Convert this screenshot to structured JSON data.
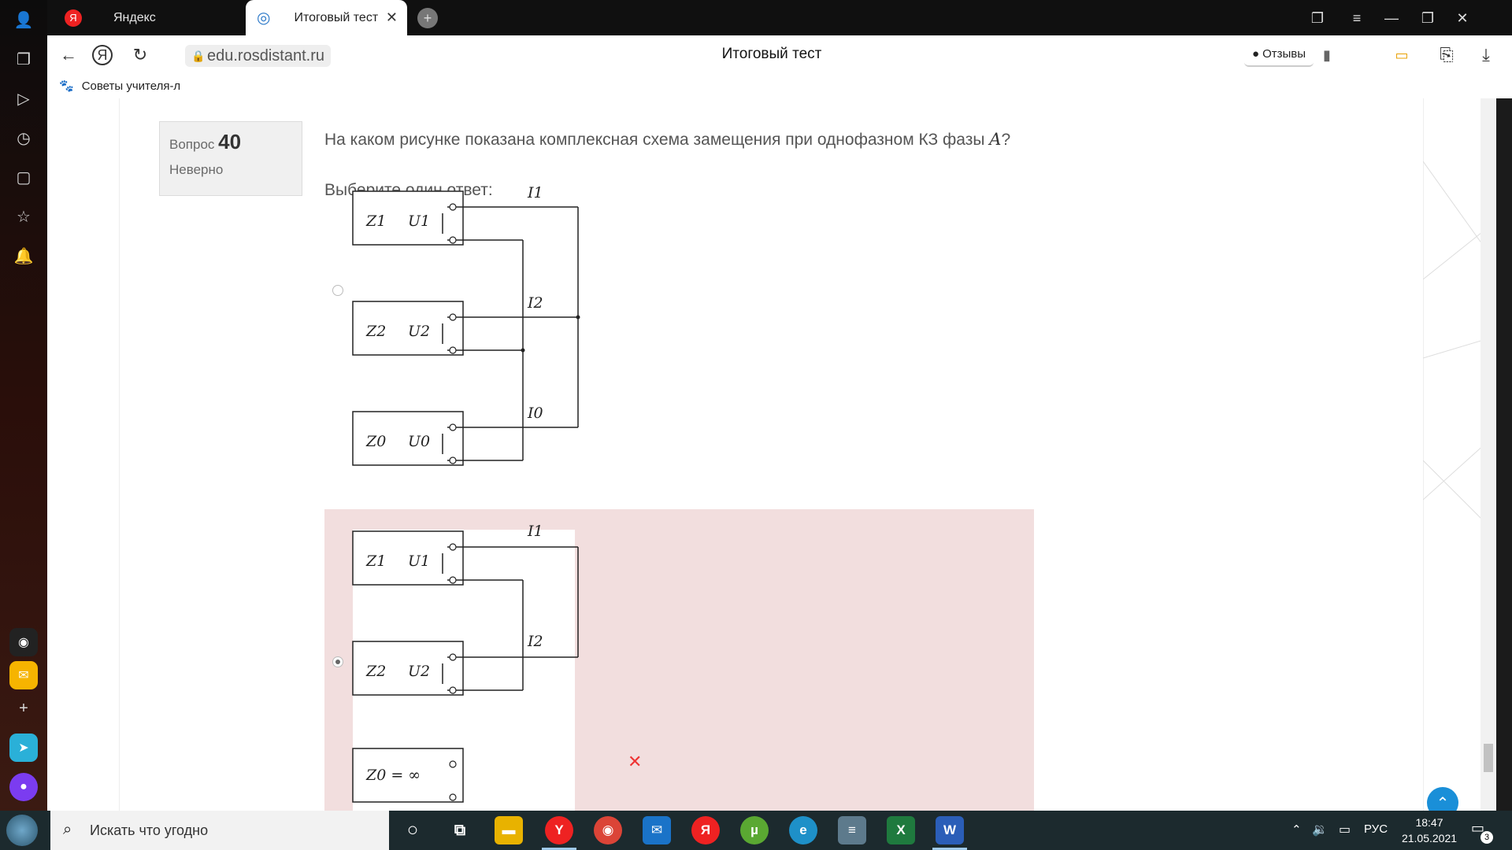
{
  "browser": {
    "tabs": [
      {
        "label": "Яндекс",
        "icon": "yandex-icon"
      },
      {
        "label": "Итоговый тест",
        "icon": "globe-icon"
      }
    ],
    "url": "edu.rosdistant.ru",
    "page_title": "Итоговый тест",
    "reviews_label": "Отзывы",
    "bookmark": "Советы учителя-л"
  },
  "question": {
    "prefix": "Вопрос",
    "number": "40",
    "state": "Неверно",
    "text": "На каком рисунке показана комплексная схема замещения при однофазном КЗ фазы",
    "phase": "A",
    "qmark": "?",
    "prompt": "Выберите один ответ:",
    "answers": [
      {
        "selected": false,
        "correct": null
      },
      {
        "selected": true,
        "correct": false
      }
    ]
  },
  "scheme_a": {
    "z": [
      "Z1",
      "Z2",
      "Z0"
    ],
    "u": [
      "U1",
      "U2",
      "U0"
    ],
    "i": [
      "I1",
      "I2",
      "I0"
    ]
  },
  "scheme_b": {
    "z": [
      "Z1",
      "Z2"
    ],
    "u": [
      "U1",
      "U2"
    ],
    "i": [
      "I1",
      "I2"
    ],
    "z0_label": "Z0 = ∞"
  },
  "taskbar": {
    "search_placeholder": "Искать что угодно",
    "lang": "РУС",
    "time": "18:47",
    "date": "21.05.2021",
    "notifications": "3"
  },
  "colors": {
    "incorrect_bg": "#f2dede",
    "incorrect_mark": "#e33333",
    "totop": "#1a8fd8"
  }
}
